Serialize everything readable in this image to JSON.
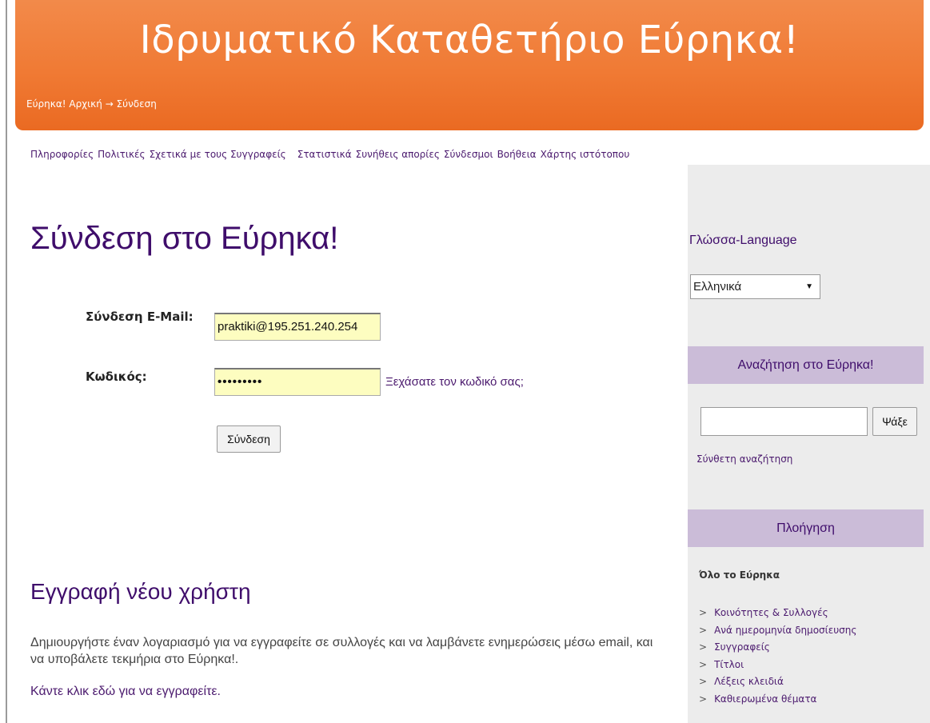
{
  "header": {
    "title": "Ιδρυματικό Καταθετήριο Εύρηκα!",
    "breadcrumb": {
      "home": "Εύρηκα! Αρχική",
      "separator": "→",
      "current": "Σύνδεση"
    }
  },
  "topnav": {
    "items": [
      "Πληροφορίες",
      "Πολιτικές",
      "Σχετικά με τους Συγγραφείς",
      "Στατιστικά",
      "Συνήθεις απορίες",
      "Σύνδεσμοι",
      "Βοήθεια",
      "Χάρτης ιστότοπου"
    ]
  },
  "login": {
    "title": "Σύνδεση στο Εύρηκα!",
    "email_label": "Σύνδεση E-Mail:",
    "email_value": "praktiki@195.251.240.254",
    "password_label": "Κωδικός:",
    "password_value": "•••••••••",
    "forgot_link": "Ξεχάσατε τον κωδικό σας;",
    "submit_label": "Σύνδεση"
  },
  "register": {
    "title": "Εγγραφή νέου χρήστη",
    "description": "Δημιουργήστε έναν λογαριασμό για να εγγραφείτε σε συλλογές και να λαμβάνετε ενημερώσεις μέσω email, και να υποβάλετε τεκμήρια στο Εύρηκα!.",
    "link": "Κάντε κλικ εδώ για να εγγραφείτε."
  },
  "sidebar": {
    "language": {
      "title": "Γλώσσα-Language",
      "selected": "Ελληνικά"
    },
    "search": {
      "title": "Αναζήτηση στο Εύρηκα!",
      "button_label": "Ψάξε",
      "input_value": "",
      "advanced_link": "Σύνθετη αναζήτηση"
    },
    "navigation": {
      "title": "Πλοήγηση",
      "all_label": "Όλο το Εύρηκα",
      "arrow": ">",
      "items": [
        "Κοινότητες & Συλλογές",
        "Ανά ημερομηνία δημοσίευσης",
        "Συγγραφείς",
        "Τίτλοι",
        "Λέξεις κλειδιά",
        "Καθιερωμένα θέματα"
      ]
    }
  },
  "colors": {
    "header_orange": "#f07a34",
    "accent_purple": "#3f0d6b",
    "sidebar_box": "#cbbcd8",
    "field_yellow": "#fdfdc0"
  }
}
